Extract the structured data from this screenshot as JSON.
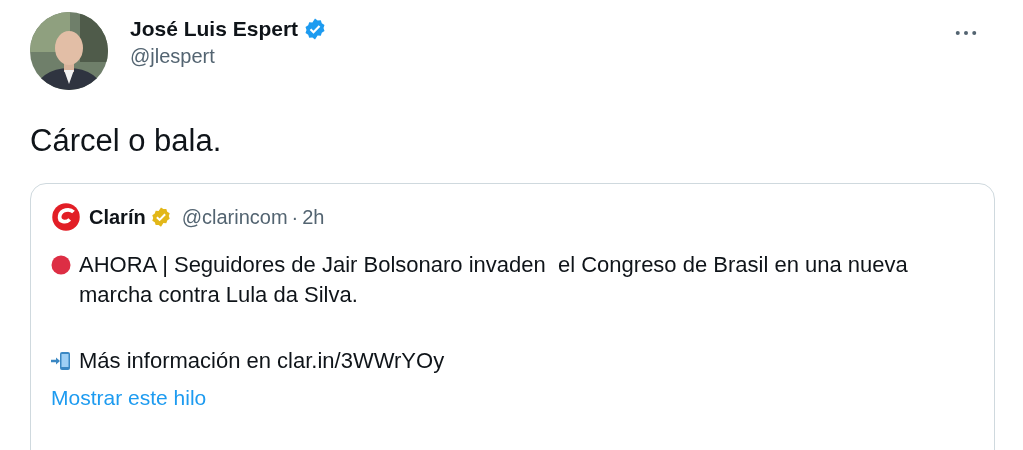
{
  "author": {
    "name": "José Luis Espert",
    "handle": "@jlespert",
    "verified": true,
    "organization": false
  },
  "tweet_text": "Cárcel o bala.",
  "quoted": {
    "author": {
      "name": "Clarín",
      "handle": "@clarincom",
      "separator": "·",
      "time": "2h",
      "verified": true,
      "organization": true
    },
    "paragraphs": [
      {
        "kind": "red-circle",
        "text": "AHORA | Seguidores de Jair Bolsonaro invaden  el Congreso de Brasil en una nueva marcha contra Lula da Silva."
      },
      {
        "kind": "phone-arrow",
        "text": "Más información en clar.in/3WWrYOy"
      }
    ],
    "thread_link": "Mostrar este hilo"
  }
}
